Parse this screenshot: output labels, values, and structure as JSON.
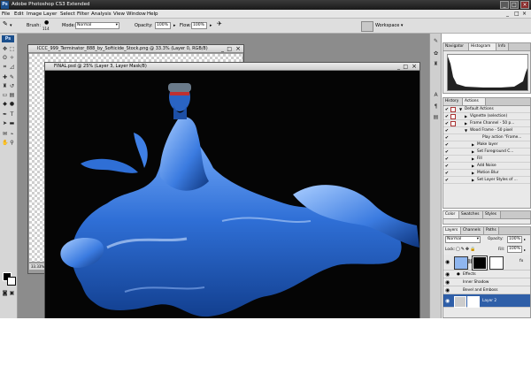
{
  "window": {
    "title": "Adobe Photoshop CS3 Extended",
    "app_badge": "Ps",
    "min_glyph": "_",
    "max_glyph": "□",
    "close_glyph": "×"
  },
  "menu": [
    "File",
    "Edit",
    "Image",
    "Layer",
    "Select",
    "Filter",
    "Analysis",
    "View",
    "Window",
    "Help"
  ],
  "options_bar": {
    "brush_label": "Brush:",
    "brush_size": "114",
    "mode_label": "Mode:",
    "mode_value": "Normal",
    "opacity_label": "Opacity:",
    "opacity_value": "100%",
    "flow_label": "Flow:",
    "flow_value": "100%",
    "workspace_label": "Workspace ▾"
  },
  "documents": {
    "back": {
      "title": "ICCC_999_Terminator_888_by_Softicide_Stock.png @ 33.3% (Layer 0, RGB/8)",
      "zoom": "33.33%"
    },
    "front": {
      "title": "FINAL.psd @ 25% (Layer 3, Layer Mask/8)"
    }
  },
  "panels": {
    "navigator_tabs": [
      "Navigator",
      "Histogram",
      "Info"
    ],
    "actions_tabs": [
      "History",
      "Actions"
    ],
    "actions": [
      {
        "label": "Default Actions",
        "indent": 0,
        "expanded": false,
        "type": "set"
      },
      {
        "label": "Vignette (selection)",
        "indent": 1,
        "type": "action"
      },
      {
        "label": "Frame Channel - 50 p...",
        "indent": 1,
        "type": "action"
      },
      {
        "label": "Wood Frame - 50 pixel",
        "indent": 1,
        "type": "action",
        "expanded": true
      },
      {
        "label": "Play action \"Frame...",
        "indent": 3,
        "type": "step"
      },
      {
        "label": "Make layer",
        "indent": 2,
        "type": "step"
      },
      {
        "label": "Set Foreground C...",
        "indent": 2,
        "type": "step"
      },
      {
        "label": "Fill",
        "indent": 2,
        "type": "step"
      },
      {
        "label": "Add Noise",
        "indent": 2,
        "type": "step"
      },
      {
        "label": "Motion Blur",
        "indent": 2,
        "type": "step"
      },
      {
        "label": "Set Layer Styles of ...",
        "indent": 2,
        "type": "step"
      }
    ],
    "color_tabs": [
      "Color",
      "Swatches",
      "Styles"
    ],
    "layers_tabs": [
      "Layers",
      "Channels",
      "Paths"
    ],
    "blend_mode": "Normal",
    "opacity_label": "Opacity:",
    "opacity_value": "100%",
    "lock_label": "Lock:",
    "fill_label": "Fill:",
    "fill_value": "100%",
    "layers": [
      {
        "name": "",
        "kind": "layer-with-mask",
        "fx": "fx"
      },
      {
        "name": "Effects",
        "kind": "effects-header"
      },
      {
        "name": "Inner Shadow",
        "kind": "effect"
      },
      {
        "name": "Bevel and Emboss",
        "kind": "effect"
      },
      {
        "name": "Layer 2",
        "kind": "layer",
        "selected": true
      }
    ]
  },
  "colors": {
    "accent_blue": "#2f6fd6",
    "splash_light": "#7fb3ff",
    "canvas_black": "#050505",
    "selected_row": "#2f5fa8"
  }
}
